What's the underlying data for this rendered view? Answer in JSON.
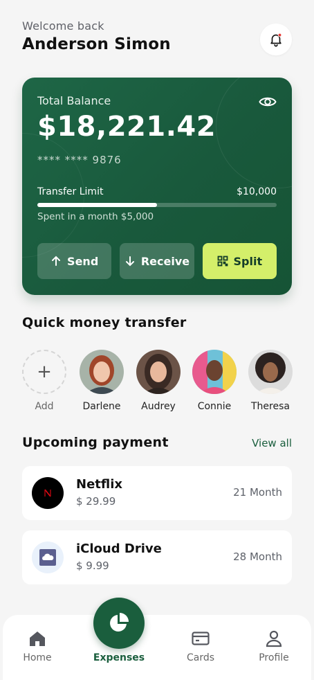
{
  "header": {
    "greeting": "Welcome back",
    "user_name": "Anderson Simon",
    "notification_icon": "bell-icon"
  },
  "balance_card": {
    "label": "Total Balance",
    "amount": "$18,221.42",
    "card_number": "**** **** 9876",
    "visibility_icon": "eye-icon",
    "transfer_limit_label": "Transfer Limit",
    "transfer_limit_value": "$10,000",
    "spent_text": "Spent in a month $5,000",
    "spent_fraction": 0.5,
    "actions": {
      "send": "Send",
      "receive": "Receive",
      "split": "Split"
    },
    "colors": {
      "card": "#1a5e3d",
      "split_button": "#d4ef6a"
    }
  },
  "quick_transfer": {
    "title": "Quick money transfer",
    "add_label": "Add",
    "contacts": [
      "Darlene",
      "Audrey",
      "Connie",
      "Theresa"
    ]
  },
  "upcoming": {
    "title": "Upcoming payment",
    "view_all": "View all",
    "payments": [
      {
        "name": "Netflix",
        "price": "$ 29.99",
        "term": "21 Month",
        "icon": "netflix-logo-icon"
      },
      {
        "name": "iCloud Drive",
        "price": "$ 9.99",
        "term": "28 Month",
        "icon": "icloud-logo-icon"
      }
    ]
  },
  "bottom_nav": {
    "home": "Home",
    "expenses": "Expenses",
    "cards": "Cards",
    "profile": "Profile",
    "active": "Expenses"
  }
}
